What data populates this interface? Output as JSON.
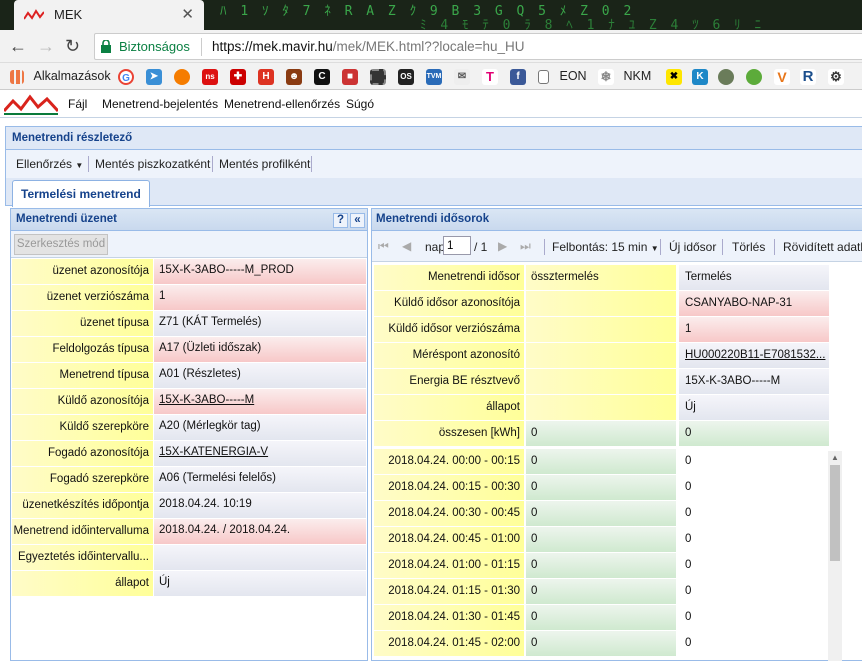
{
  "browser": {
    "tab_title": "MEK",
    "close_glyph": "✕",
    "security_label": "Biztonságos",
    "url_base": "https://mek.mavir.hu",
    "url_path": "/mek/MEK.html??locale=hu_HU",
    "matrix_rows": [
      "ﾊ 1 ｿ ﾀ 7 ﾈ R A Z ｸ 9 B 3 G Q 5 ﾒ Z 0 2",
      "ﾐ 4 ﾓ ﾃ 0 ﾗ 8 ﾍ 1 ﾅ ﾕ Z 4 ﾂ 6 ﾘ ﾆ"
    ],
    "bookmarks": [
      {
        "label": "Alkalmazások",
        "icon": "apps-grid-icon"
      },
      {
        "label": "",
        "icon": "google-icon"
      },
      {
        "label": "",
        "icon": "bookmark-arrow-icon"
      },
      {
        "label": "",
        "icon": "orange-circle-icon"
      },
      {
        "label": "",
        "icon": "ns-icon"
      },
      {
        "label": "",
        "icon": "cross-icon"
      },
      {
        "label": "",
        "icon": "h-icon"
      },
      {
        "label": "",
        "icon": "people-icon"
      },
      {
        "label": "",
        "icon": "c-icon"
      },
      {
        "label": "",
        "icon": "red-doc-icon"
      },
      {
        "label": "",
        "icon": "film-icon"
      },
      {
        "label": "",
        "icon": "os-icon"
      },
      {
        "label": "",
        "icon": "tvm-icon"
      },
      {
        "label": "",
        "icon": "mail-icon"
      },
      {
        "label": "",
        "icon": "telekom-icon"
      },
      {
        "label": "",
        "icon": "facebook-icon"
      },
      {
        "label": "EON",
        "icon": "page-icon"
      },
      {
        "label": "NKM",
        "icon": "snowflake-icon"
      },
      {
        "label": "",
        "icon": "raiffeisen-icon"
      },
      {
        "label": "",
        "icon": "k-icon"
      },
      {
        "label": "",
        "icon": "ghost-icon"
      },
      {
        "label": "",
        "icon": "frog-icon"
      },
      {
        "label": "",
        "icon": "v-icon"
      },
      {
        "label": "",
        "icon": "r-icon"
      },
      {
        "label": "",
        "icon": "gear-face-icon"
      }
    ]
  },
  "menu": {
    "items": [
      "Fájl",
      "Menetrend-bejelentés",
      "Menetrend-ellenőrzés",
      "Súgó"
    ]
  },
  "panel": {
    "title": "Menetrendi részletező",
    "toolbar": [
      "Ellenőrzés",
      "Mentés piszkozatként",
      "Mentés profilként"
    ],
    "tab": "Termelési menetrend"
  },
  "left": {
    "title": "Menetrendi üzenet",
    "help_glyph": "?",
    "collapse_glyph": "«",
    "edit_button": "Szerkesztés mód",
    "rows": [
      {
        "label": "üzenet azonosítója",
        "value": "15X-K-3ABO-----M_PROD",
        "color": "pk"
      },
      {
        "label": "üzenet verziószáma",
        "value": "1",
        "color": "pk"
      },
      {
        "label": "üzenet típusa",
        "value": "Z71 (KÁT Termelés)",
        "color": "wh"
      },
      {
        "label": "Feldolgozás típusa",
        "value": "A17 (Üzleti időszak)",
        "color": "pk"
      },
      {
        "label": "Menetrend típusa",
        "value": "A01 (Részletes)",
        "color": "wh"
      },
      {
        "label": "Küldő azonosítója",
        "value": "15X-K-3ABO-----M",
        "color": "pk",
        "link": true
      },
      {
        "label": "Küldő szerepköre",
        "value": "A20 (Mérlegkör tag)",
        "color": "wh"
      },
      {
        "label": "Fogadó azonosítója",
        "value": "15X-KATENERGIA-V",
        "color": "wh",
        "link": true
      },
      {
        "label": "Fogadó szerepköre",
        "value": "A06 (Termelési felelős)",
        "color": "wh"
      },
      {
        "label": "üzenetkészítés időpontja",
        "value": "2018.04.24. 10:19",
        "color": "wh"
      },
      {
        "label": "Menetrend időintervalluma",
        "value": "2018.04.24. / 2018.04.24.",
        "color": "pk"
      },
      {
        "label": "Egyeztetés időintervallu...",
        "value": "",
        "color": "wh"
      },
      {
        "label": "állapot",
        "value": "Új",
        "color": "wh"
      }
    ]
  },
  "right": {
    "title": "Menetrendi idősorok",
    "page_label": "nap",
    "page_value": "1",
    "page_total": "/ 1",
    "resolution_label": "Felbontás: 15 min",
    "new_series": "Új idősor",
    "delete": "Törlés",
    "shortened": "Rövidített adatb",
    "header_rows": [
      {
        "label": "Menetrendi idősor",
        "v1": "össztermelés",
        "v2": "Termelés",
        "c2": "yl",
        "c3": "wh"
      },
      {
        "label": "Küldő idősor azonosítója",
        "v1": "",
        "v2": "CSANYABO-NAP-31",
        "c2": "yl",
        "c3": "pk"
      },
      {
        "label": "Küldő idősor verziószáma",
        "v1": "",
        "v2": "1",
        "c2": "yl",
        "c3": "pk"
      },
      {
        "label": "Mérés­pont azonosító",
        "v1": "",
        "v2": "HU000220B11-E7081532...",
        "c2": "yl",
        "c3": "wh",
        "link": true
      },
      {
        "label": "Energia BE résztvevő",
        "v1": "",
        "v2": "15X-K-3ABO-----M",
        "c2": "yl",
        "c3": "wh"
      },
      {
        "label": "állapot",
        "v1": "",
        "v2": "Új",
        "c2": "yl",
        "c3": "wh"
      },
      {
        "label": "összesen [kWh]",
        "v1": "0",
        "v2": "0",
        "c2": "gr",
        "c3": "gr"
      }
    ],
    "time_rows": [
      {
        "label": "2018.04.24. 00:00 - 00:15",
        "v1": "0",
        "v2": "0"
      },
      {
        "label": "2018.04.24. 00:15 - 00:30",
        "v1": "0",
        "v2": "0"
      },
      {
        "label": "2018.04.24. 00:30 - 00:45",
        "v1": "0",
        "v2": "0"
      },
      {
        "label": "2018.04.24. 00:45 - 01:00",
        "v1": "0",
        "v2": "0"
      },
      {
        "label": "2018.04.24. 01:00 - 01:15",
        "v1": "0",
        "v2": "0"
      },
      {
        "label": "2018.04.24. 01:15 - 01:30",
        "v1": "0",
        "v2": "0"
      },
      {
        "label": "2018.04.24. 01:30 - 01:45",
        "v1": "0",
        "v2": "0"
      },
      {
        "label": "2018.04.24. 01:45 - 02:00",
        "v1": "0",
        "v2": "0"
      }
    ]
  },
  "colors": {
    "header_blue": "#15428b",
    "panel_border": "#99bbe8",
    "secure_green": "#0b8043"
  }
}
